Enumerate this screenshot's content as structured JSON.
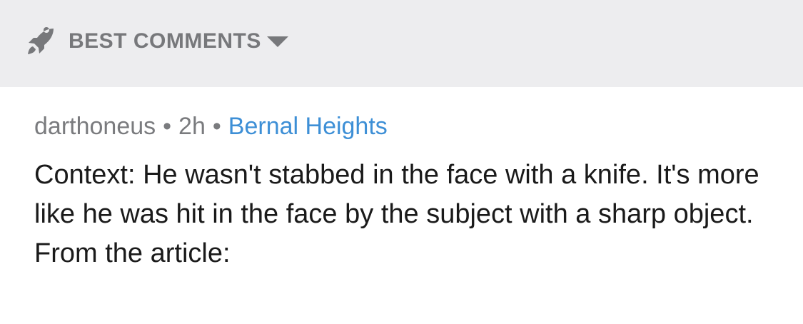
{
  "sort": {
    "icon": "rocket-icon",
    "label": "BEST COMMENTS",
    "dropdown_icon": "caret-down-icon"
  },
  "comment": {
    "author": "darthoneus",
    "separator": "•",
    "age": "2h",
    "location": "Bernal Heights",
    "body": "Context: He wasn't stabbed in the face with a knife. It's more like he was hit in the face by the subject with a sharp object. From the article:"
  },
  "colors": {
    "header_bg": "#ededef",
    "header_text": "#77787b",
    "meta_text": "#7a7b7e",
    "link": "#3d8fd6",
    "body_text": "#1a1a1a"
  }
}
